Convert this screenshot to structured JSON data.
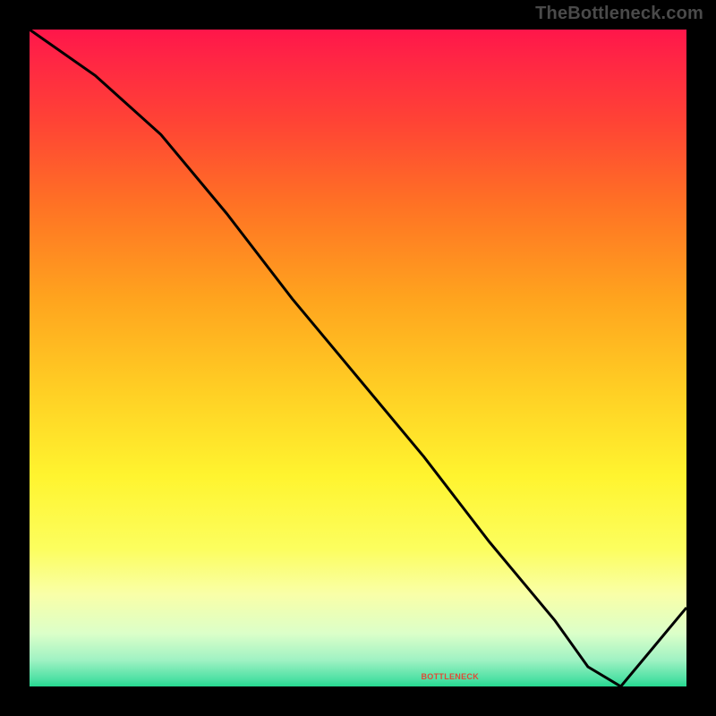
{
  "watermark": "TheBottleneck.com",
  "tiny_label": "BOTTLENECK",
  "chart_data": {
    "type": "line",
    "title": "",
    "xlabel": "",
    "ylabel": "",
    "xlim": [
      0,
      100
    ],
    "ylim": [
      0,
      100
    ],
    "series": [
      {
        "name": "curve",
        "x": [
          0,
          10,
          20,
          30,
          40,
          50,
          60,
          70,
          80,
          85,
          90,
          95,
          100
        ],
        "y": [
          100,
          93,
          84,
          72,
          59,
          47,
          35,
          22,
          10,
          3,
          0,
          6,
          12
        ]
      }
    ],
    "gradient_stops": [
      {
        "pos": 0,
        "color": "#ff164a"
      },
      {
        "pos": 86,
        "color": "#f9ffa8"
      },
      {
        "pos": 100,
        "color": "#25d990"
      }
    ]
  }
}
